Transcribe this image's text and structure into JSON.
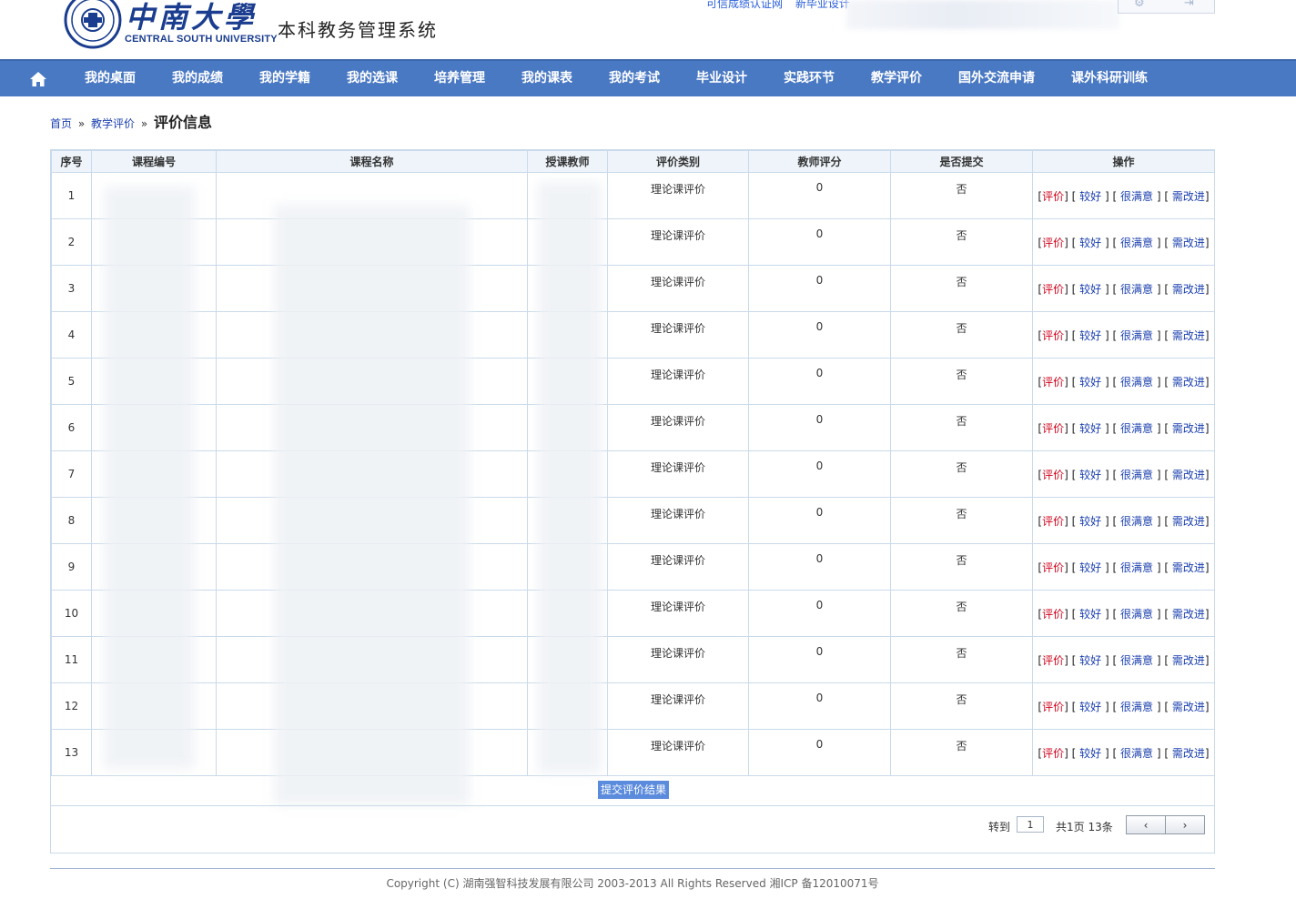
{
  "header": {
    "logo_cn": "中南大學",
    "logo_en": "CENTRAL SOUTH UNIVERSITY",
    "system_name": "本科教务管理系统",
    "top_links": [
      "可信成绩认证网",
      "新毕业设计"
    ]
  },
  "nav": {
    "home_icon": "home-icon",
    "items": [
      "我的桌面",
      "我的成绩",
      "我的学籍",
      "我的选课",
      "培养管理",
      "我的课表",
      "我的考试",
      "毕业设计",
      "实践环节",
      "教学评价",
      "国外交流申请",
      "课外科研训练"
    ]
  },
  "breadcrumb": {
    "home": "首页",
    "separator": "»",
    "section": "教学评价",
    "current": "评价信息"
  },
  "table": {
    "headers": [
      "序号",
      "课程编号",
      "课程名称",
      "授课教师",
      "评价类别",
      "教师评分",
      "是否提交",
      "操作"
    ],
    "rows": [
      {
        "no": "1",
        "course_id": "",
        "course_name": "",
        "teacher": "",
        "category": "理论课评价",
        "score": "0",
        "submitted": "否"
      },
      {
        "no": "2",
        "course_id": "",
        "course_name": "",
        "teacher": "",
        "category": "理论课评价",
        "score": "0",
        "submitted": "否"
      },
      {
        "no": "3",
        "course_id": "",
        "course_name": "",
        "teacher": "",
        "category": "理论课评价",
        "score": "0",
        "submitted": "否"
      },
      {
        "no": "4",
        "course_id": "",
        "course_name": "",
        "teacher": "",
        "category": "理论课评价",
        "score": "0",
        "submitted": "否"
      },
      {
        "no": "5",
        "course_id": "",
        "course_name": "",
        "teacher": "",
        "category": "理论课评价",
        "score": "0",
        "submitted": "否"
      },
      {
        "no": "6",
        "course_id": "",
        "course_name": "",
        "teacher": "",
        "category": "理论课评价",
        "score": "0",
        "submitted": "否"
      },
      {
        "no": "7",
        "course_id": "",
        "course_name": "",
        "teacher": "",
        "category": "理论课评价",
        "score": "0",
        "submitted": "否"
      },
      {
        "no": "8",
        "course_id": "",
        "course_name": "",
        "teacher": "",
        "category": "理论课评价",
        "score": "0",
        "submitted": "否"
      },
      {
        "no": "9",
        "course_id": "",
        "course_name": "",
        "teacher": "",
        "category": "理论课评价",
        "score": "0",
        "submitted": "否"
      },
      {
        "no": "10",
        "course_id": "",
        "course_name": "",
        "teacher": "",
        "category": "理论课评价",
        "score": "0",
        "submitted": "否"
      },
      {
        "no": "11",
        "course_id": "",
        "course_name": "",
        "teacher": "",
        "category": "理论课评价",
        "score": "0",
        "submitted": "否"
      },
      {
        "no": "12",
        "course_id": "",
        "course_name": "",
        "teacher": "",
        "category": "理论课评价",
        "score": "0",
        "submitted": "否"
      },
      {
        "no": "13",
        "course_id": "",
        "course_name": "",
        "teacher": "",
        "category": "理论课评价",
        "score": "0",
        "submitted": "否"
      }
    ],
    "actions": {
      "evaluate": "评价",
      "good": "较好",
      "very_satisfied": "很满意",
      "needs_improvement": "需改进"
    }
  },
  "submit_button": "提交评价结果",
  "pager": {
    "goto_label": "转到",
    "page_value": "1",
    "summary": "共1页 13条",
    "prev": "‹",
    "next": "›"
  },
  "footer": {
    "copyright": "Copyright (C) 湖南强智科技发展有限公司 2003-2013 All Rights Reserved 湘ICP 备12010071号"
  },
  "colors": {
    "nav_bg": "#4a79c4",
    "link": "#1a3fae",
    "action_red": "#d0021b",
    "submit_bg": "#5b8bdc",
    "grid_border": "#c9daea"
  }
}
